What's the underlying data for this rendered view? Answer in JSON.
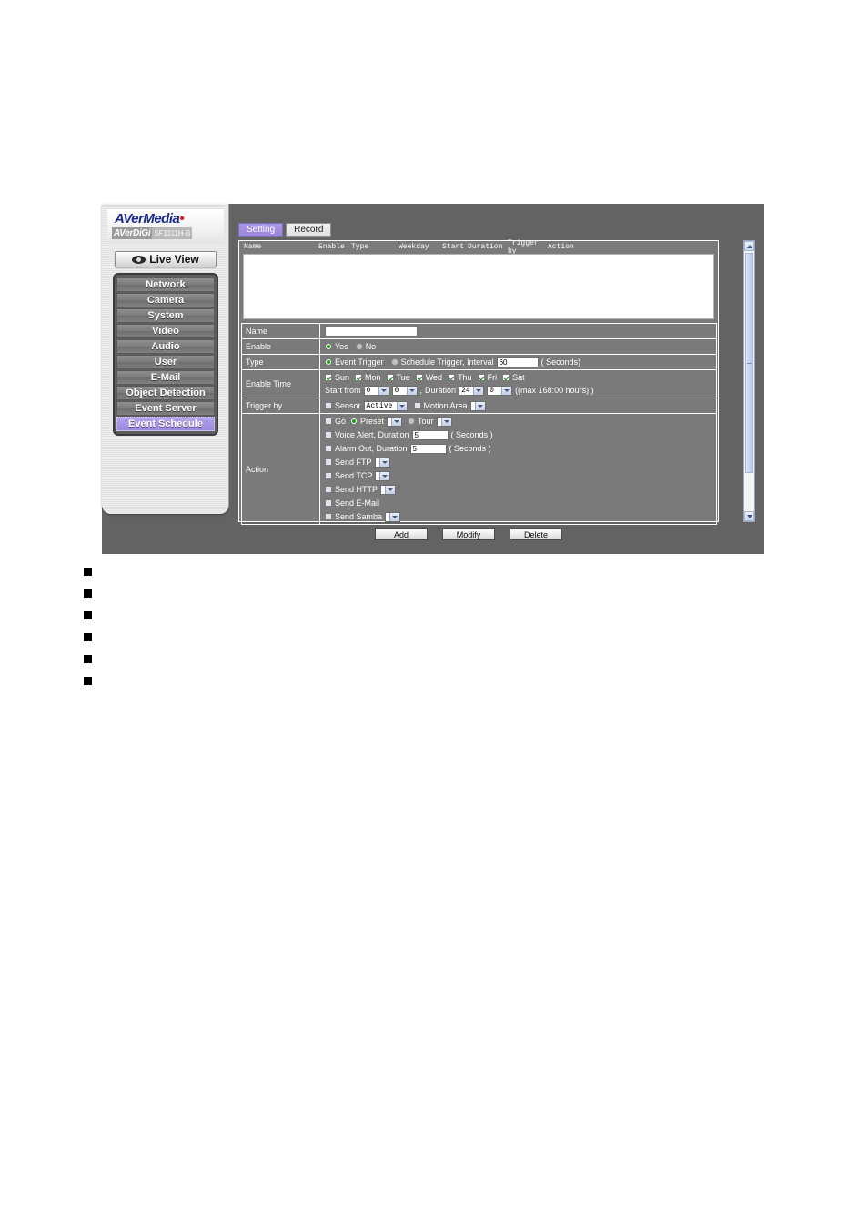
{
  "device_ui": {
    "brand": {
      "logo_primary": "AVerMedia",
      "logo_secondary_a": "AVerDiGi",
      "logo_secondary_b": "SF1311H-B"
    },
    "live_view_button": "Live View",
    "accent_color": "#a18fe3",
    "panel_bg_color": "#7a7a7a",
    "window_bg_color": "#636363",
    "sidebar": {
      "items": [
        {
          "label": "Network",
          "active": false
        },
        {
          "label": "Camera",
          "active": false
        },
        {
          "label": "System",
          "active": false
        },
        {
          "label": "Video",
          "active": false
        },
        {
          "label": "Audio",
          "active": false
        },
        {
          "label": "User",
          "active": false
        },
        {
          "label": "E-Mail",
          "active": false
        },
        {
          "label": "Object Detection",
          "active": false
        },
        {
          "label": "Event Server",
          "active": false
        },
        {
          "label": "Event Schedule",
          "active": true
        }
      ]
    },
    "tabs": [
      {
        "label": "Setting",
        "active": true
      },
      {
        "label": "Record",
        "active": false
      }
    ],
    "list": {
      "columns": [
        "Name",
        "Enable",
        "Type",
        "Weekday",
        "Start",
        "Duration",
        "Trigger by",
        "Action"
      ],
      "rows": []
    },
    "form": {
      "name": {
        "label": "Name",
        "value": "",
        "placeholder": ""
      },
      "enable": {
        "label": "Enable",
        "yes_label": "Yes",
        "no_label": "No",
        "selected": "Yes"
      },
      "type": {
        "label": "Type",
        "event_trigger_label": "Event Trigger",
        "schedule_trigger_label": "Schedule Trigger, Interval",
        "selected": "Event Trigger",
        "interval_value": "60",
        "interval_unit": "( Seconds)"
      },
      "enable_time": {
        "label": "Enable Time",
        "weekdays": [
          {
            "label": "Sun",
            "checked": true
          },
          {
            "label": "Mon",
            "checked": true
          },
          {
            "label": "Tue",
            "checked": true
          },
          {
            "label": "Wed",
            "checked": true
          },
          {
            "label": "Thu",
            "checked": true
          },
          {
            "label": "Fri",
            "checked": true
          },
          {
            "label": "Sat",
            "checked": true
          }
        ],
        "start_from_label": "Start from",
        "start_hour": "0",
        "start_minute": "0",
        "comma": ",",
        "duration_label": "Duration",
        "duration_hour": "24",
        "duration_minute": "0",
        "max_note": "((max 168:00 hours) )"
      },
      "trigger_by": {
        "label": "Trigger by",
        "sensor_label": "Sensor",
        "sensor_checked": false,
        "sensor_value": "Active",
        "motion_area_label": "Motion Area",
        "motion_area_checked": false,
        "motion_area_value": ""
      },
      "action": {
        "label": "Action",
        "go": {
          "label": "Go",
          "checked": false,
          "preset_label": "Preset",
          "preset_selected": true,
          "preset_value": "",
          "tour_label": "Tour",
          "tour_selected": false,
          "tour_value": ""
        },
        "voice_alert": {
          "label": "Voice Alert, Duration",
          "checked": false,
          "value": "5",
          "unit": "( Seconds )"
        },
        "alarm_out": {
          "label": "Alarm Out, Duration",
          "checked": false,
          "value": "5",
          "unit": "( Seconds )"
        },
        "send_items": [
          {
            "label": "Send FTP",
            "checked": false,
            "has_select": true,
            "value": ""
          },
          {
            "label": "Send TCP",
            "checked": false,
            "has_select": true,
            "value": ""
          },
          {
            "label": "Send HTTP",
            "checked": false,
            "has_select": true,
            "value": ""
          },
          {
            "label": "Send E-Mail",
            "checked": false,
            "has_select": false,
            "value": ""
          },
          {
            "label": "Send Samba",
            "checked": false,
            "has_select": true,
            "value": ""
          }
        ]
      }
    },
    "buttons": {
      "add": "Add",
      "modify": "Modify",
      "delete": "Delete"
    }
  },
  "bullets": [
    {
      "text": ""
    },
    {
      "text": ""
    },
    {
      "text": ""
    },
    {
      "text": ""
    },
    {
      "text": ""
    },
    {
      "text": ""
    }
  ]
}
